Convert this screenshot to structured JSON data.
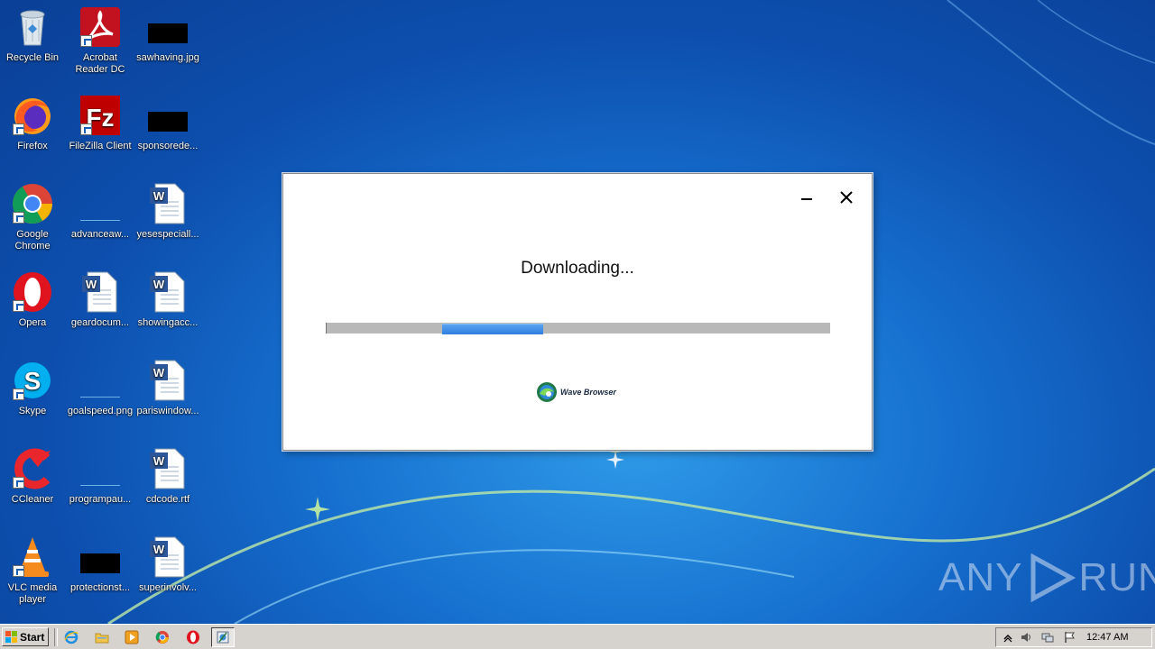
{
  "desktop": {
    "icons": [
      {
        "label": "Recycle Bin",
        "icon": "recycle-bin-icon"
      },
      {
        "label": "Acrobat Reader DC",
        "icon": "acrobat-icon"
      },
      {
        "label": "sawhaving.jpg",
        "icon": "image-file-icon"
      },
      {
        "label": "Firefox",
        "icon": "firefox-icon"
      },
      {
        "label": "FileZilla Client",
        "icon": "filezilla-icon"
      },
      {
        "label": "sponsorede...",
        "icon": "image-file-icon"
      },
      {
        "label": "Google Chrome",
        "icon": "chrome-icon"
      },
      {
        "label": "advanceaw...",
        "icon": "image-file-icon"
      },
      {
        "label": "yesespeciall...",
        "icon": "word-doc-icon"
      },
      {
        "label": "Opera",
        "icon": "opera-icon"
      },
      {
        "label": "geardocum...",
        "icon": "word-doc-icon"
      },
      {
        "label": "showingacc...",
        "icon": "word-doc-icon"
      },
      {
        "label": "Skype",
        "icon": "skype-icon"
      },
      {
        "label": "goalspeed.png",
        "icon": "image-file-icon"
      },
      {
        "label": "pariswindow...",
        "icon": "word-doc-icon"
      },
      {
        "label": "CCleaner",
        "icon": "ccleaner-icon"
      },
      {
        "label": "programpau...",
        "icon": "image-file-icon"
      },
      {
        "label": "cdcode.rtf",
        "icon": "word-doc-icon"
      },
      {
        "label": "VLC media player",
        "icon": "vlc-icon"
      },
      {
        "label": "protectionst...",
        "icon": "image-file-icon"
      },
      {
        "label": "superinvolv...",
        "icon": "word-doc-icon"
      }
    ]
  },
  "dialog": {
    "title": "Downloading...",
    "progress_start": 0.23,
    "progress_end": 0.43,
    "brand_name": "Wave Browser"
  },
  "watermark": {
    "left": "ANY",
    "right": "RUN"
  },
  "taskbar": {
    "start_label": "Start",
    "pinned": [
      "internet-explorer-icon",
      "folder-icon",
      "media-player-icon",
      "chrome-icon",
      "opera-icon",
      "installer-icon"
    ],
    "clock": "12:47 AM"
  },
  "colors": {
    "progress_fill": "#2f7ee0",
    "progress_track": "#b8b8b8",
    "taskbar": "#d6d3ce"
  }
}
